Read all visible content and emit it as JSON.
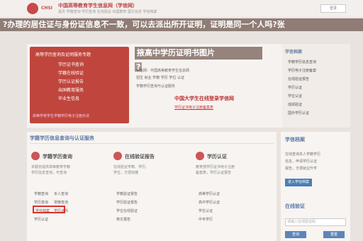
{
  "header": {
    "logo_text": "CHSI",
    "site_title": "中国高等教育学生信息网（学信网）",
    "tabs": "首页  学籍查询  学历查询  在线验证  出国教育  图文信息  学信档案",
    "login_label": "登录"
  },
  "overlay": {
    "line1": "?办理的居住证与身份证信息不一致，可以去派出所开证明，证明是同一个人吗?张",
    "line2": "掖高中学历证明书图片",
    "line3": "?"
  },
  "banner": {
    "title": "高等学历查询及证明服务专题",
    "items": [
      "学历证书查询",
      "学籍在线验证",
      "学历认证报告",
      "出国教育服务",
      "毕业生信息"
    ],
    "footer": "高等学校学生学籍学历电子注册办法"
  },
  "notices": {
    "line1": "学信网：中国高等教育学生信息网",
    "line2": "招生  就业  学籍  学历  学位  认证",
    "line3": "学籍学历查询与认证服务",
    "title": "中国大学生在线登录学信网",
    "line4": "学历证书电子注册备案表"
  },
  "side": {
    "head": "学信档案",
    "items": [
      "学籍学历信息查询",
      "学历电子注册备案",
      "在线验证报告",
      "学历认证",
      "学位认证",
      "成绩验证",
      "国外学历认证"
    ]
  },
  "services": {
    "head": "学籍学历信息查询与认证服务",
    "columns": [
      {
        "title": "学籍学历查询",
        "desc": [
          "本服务提供高等教育学籍",
          "学历信息查询，可查询"
        ],
        "links": [
          "学籍查询",
          "本人查询",
          "学历查询",
          "零散查询",
          "学信档案",
          "学历证书",
          "学历认证"
        ]
      },
      {
        "title": "在线验证报告",
        "desc": [
          "在线验证学籍、学历、",
          "学位，方便快捷"
        ],
        "links": [
          "学籍验证报告",
          "学历验证报告",
          "学位在线验证",
          "英文报告"
        ]
      },
      {
        "title": "学历认证",
        "desc": [
          "教育部学历证书电子注册",
          "备案表，学历认证报告"
        ],
        "links": [
          "高等学历认证",
          "高中学历认证",
          "学位认证",
          "中专学历"
        ]
      }
    ],
    "highlighted_link": "学历证书"
  },
  "right": {
    "head1": "学信档案",
    "text1": [
      "在线查询本人学籍学历",
      "信息，申请学历认证",
      "报告，方便就业升学"
    ],
    "button": "进入学信档案",
    "head2": "在线验证",
    "input_placeholder": "请输入在线验证码",
    "btn_verify": "查询",
    "btn_reset": "重置"
  }
}
